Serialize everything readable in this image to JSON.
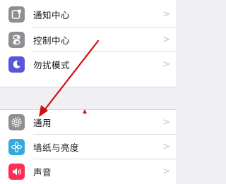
{
  "settings": {
    "group1": [
      {
        "label": "通知中心",
        "icon": "notification-center-icon",
        "color": "#8e8e93"
      },
      {
        "label": "控制中心",
        "icon": "control-center-icon",
        "color": "#8e8e93"
      },
      {
        "label": "勿扰模式",
        "icon": "moon-icon",
        "color": "#5856d6"
      }
    ],
    "group2": [
      {
        "label": "通用",
        "icon": "gear-icon",
        "color": "#8e8e93"
      },
      {
        "label": "墙纸与亮度",
        "icon": "wallpaper-flower-icon",
        "color": "#34aadc"
      },
      {
        "label": "声音",
        "icon": "speaker-icon",
        "color": "#ff2d55"
      }
    ],
    "chevron": ">"
  },
  "annotation": {
    "arrow_color": "#d01010",
    "points_to": "通用"
  }
}
